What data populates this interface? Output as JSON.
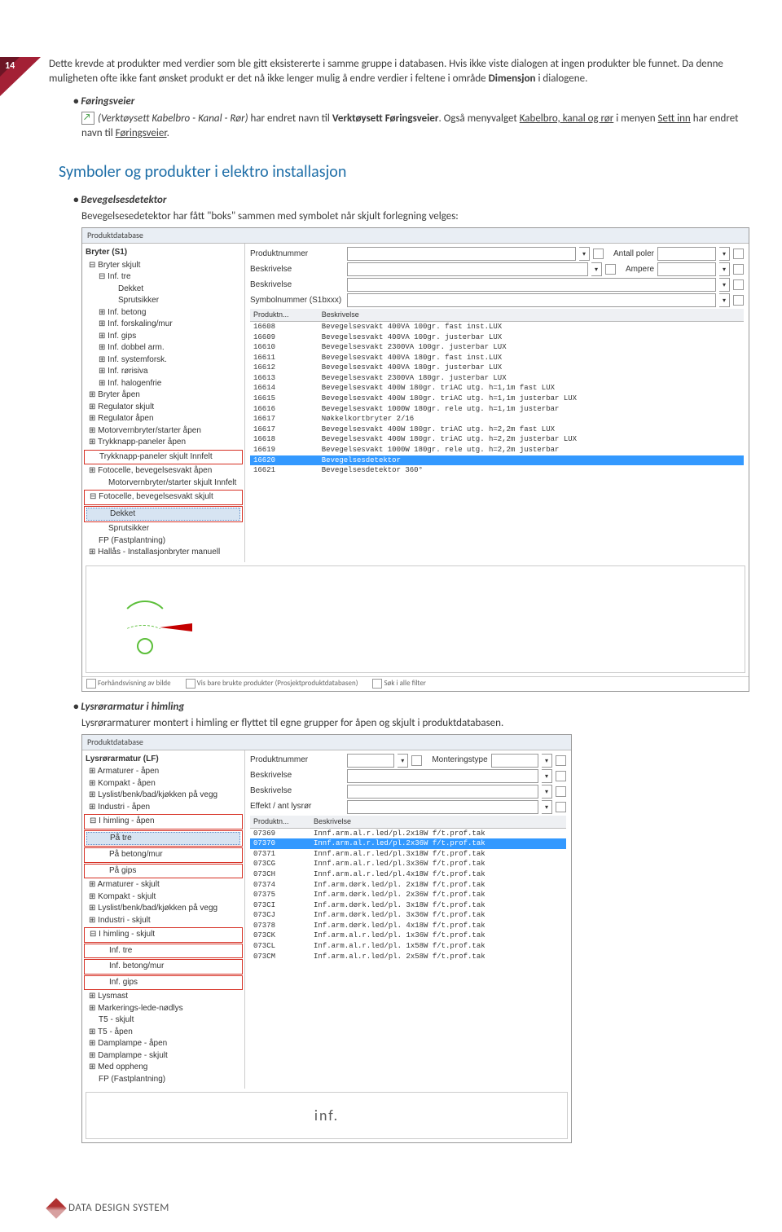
{
  "pagebadge": "14",
  "intro": {
    "para": "Dette krevde at produkter med verdier som ble gitt eksistererte i samme gruppe i databasen. Hvis ikke viste dialogen at ingen produkter ble funnet. Da denne muligheten ofte ikke fant ønsket produkt er det nå ikke lenger mulig å endre verdier i feltene i område ",
    "bold1": "Dimensjon",
    "para_end": " i dialogene."
  },
  "foringsveier": {
    "bullet": "Føringsveier",
    "text_a": "(Verktøysett Kabelbro - Kanal - Rør)",
    "text_b": " har endret navn til ",
    "bold": "Verktøysett Føringsveier",
    "text_c": ". Også menyvalget ",
    "link1": "Kabelbro, kanal og rør",
    "text_d": " i menyen ",
    "link2": "Sett inn",
    "text_e": " har endret navn til ",
    "link3": "Føringsveier",
    "text_f": "."
  },
  "h2": "Symboler og produkter i elektro  installasjon",
  "bevegelse": {
    "bullet": "Bevegelsesdetektor",
    "lead": "Bevegelsesedetektor har fått \"boks\" sammen med symbolet når skjult forlegning velges:",
    "title": "Produktdatabase",
    "tree_header": "Bryter (S1)",
    "tree": [
      {
        "ind": 0,
        "t": "Bryter skjult",
        "exp": "−"
      },
      {
        "ind": 1,
        "t": "Inf. tre",
        "exp": "−"
      },
      {
        "ind": 2,
        "t": "Dekket"
      },
      {
        "ind": 2,
        "t": "Sprutsikker"
      },
      {
        "ind": 1,
        "t": "Inf. betong",
        "exp": "+"
      },
      {
        "ind": 1,
        "t": "Inf. forskaling/mur",
        "exp": "+"
      },
      {
        "ind": 1,
        "t": "Inf. gips",
        "exp": "+"
      },
      {
        "ind": 1,
        "t": "Inf. dobbel arm.",
        "exp": "+"
      },
      {
        "ind": 1,
        "t": "Inf. systemforsk.",
        "exp": "+"
      },
      {
        "ind": 1,
        "t": "Inf. rørisiva",
        "exp": "+"
      },
      {
        "ind": 1,
        "t": "Inf. halogenfrie",
        "exp": "+"
      },
      {
        "ind": 0,
        "t": "Bryter åpen",
        "exp": "+"
      },
      {
        "ind": 0,
        "t": "Regulator skjult",
        "exp": "+"
      },
      {
        "ind": 0,
        "t": "Regulator åpen",
        "exp": "+"
      },
      {
        "ind": 0,
        "t": "Motorvernbryter/starter åpen",
        "exp": "+"
      },
      {
        "ind": 0,
        "t": "Trykknapp-paneler åpen",
        "exp": "+"
      },
      {
        "ind": 0,
        "t": "Trykknapp-paneler skjult Innfelt",
        "box": true
      },
      {
        "ind": 0,
        "t": "Fotocelle, bevegelsesvakt åpen",
        "exp": "+"
      },
      {
        "ind": 1,
        "t": "Motorvernbryter/starter skjult Innfelt"
      },
      {
        "ind": 0,
        "t": "Fotocelle, bevegelsesvakt skjult",
        "exp": "−",
        "box": true
      },
      {
        "ind": 1,
        "t": "Dekket",
        "sel": true,
        "box": true
      },
      {
        "ind": 1,
        "t": "Sprutsikker"
      },
      {
        "ind": 0,
        "t": "FP (Fastplantning)"
      },
      {
        "ind": 0,
        "t": "Hallås - Installasjonbryter manuell",
        "exp": "+"
      }
    ],
    "filters": [
      {
        "label": "Produktnummer",
        "right": "Antall poler"
      },
      {
        "label": "Beskrivelse",
        "right": "Ampere"
      },
      {
        "label": "Beskrivelse",
        "right": ""
      },
      {
        "label": "Symbolnummer (S1bxxx)",
        "right": ""
      }
    ],
    "cols": [
      "Produktn...",
      "Beskrivelse"
    ],
    "rows": [
      {
        "id": "16608",
        "d": "Bevegelsesvakt 400VA 100gr. fast inst.LUX"
      },
      {
        "id": "16609",
        "d": "Bevegelsesvakt 400VA 100gr. justerbar LUX"
      },
      {
        "id": "16610",
        "d": "Bevegelsesvakt 2300VA 100gr. justerbar LUX"
      },
      {
        "id": "16611",
        "d": "Bevegelsesvakt 400VA 180gr. fast inst.LUX"
      },
      {
        "id": "16612",
        "d": "Bevegelsesvakt 400VA 180gr. justerbar LUX"
      },
      {
        "id": "16613",
        "d": "Bevegelsesvakt 2300VA 180gr. justerbar LUX"
      },
      {
        "id": "16614",
        "d": "Bevegelsesvakt 400W 180gr. triAC utg. h=1,1m fast LUX"
      },
      {
        "id": "16615",
        "d": "Bevegelsesvakt 400W 180gr. triAC utg. h=1,1m justerbar LUX"
      },
      {
        "id": "16616",
        "d": "Bevegelsesvakt 1000W 180gr. rele utg. h=1,1m justerbar"
      },
      {
        "id": "16617",
        "d": "Nøkkelkortbryter 2/16"
      },
      {
        "id": "16617",
        "d": "Bevegelsesvakt 400W 180gr. triAC utg. h=2,2m fast LUX"
      },
      {
        "id": "16618",
        "d": "Bevegelsesvakt 400W 180gr. triAC utg. h=2,2m justerbar LUX"
      },
      {
        "id": "16619",
        "d": "Bevegelsesvakt 1000W 180gr. rele utg. h=2,2m justerbar"
      },
      {
        "id": "16620",
        "d": "Bevegelsesdetektor",
        "hl": true
      },
      {
        "id": "16621",
        "d": "Bevegelsesdetektor 360°"
      }
    ],
    "status": {
      "a": "Forhåndsvisning av bilde",
      "b": "Vis bare brukte produkter (Prosjektproduktdatabasen)",
      "c": "Søk i alle filter"
    }
  },
  "lysror": {
    "bullet": "Lysrørarmatur i himling",
    "lead": "Lysrørarmaturer montert i himling er flyttet til egne grupper for åpen og skjult i produktdatabasen.",
    "title": "Produktdatabase",
    "tree_header": "Lysrørarmatur (LF)",
    "tree": [
      {
        "ind": 0,
        "t": "Armaturer - åpen",
        "exp": "+"
      },
      {
        "ind": 0,
        "t": "Kompakt - åpen",
        "exp": "+"
      },
      {
        "ind": 0,
        "t": "Lyslist/benk/bad/kjøkken på vegg",
        "exp": "+"
      },
      {
        "ind": 0,
        "t": "Industri - åpen",
        "exp": "+"
      },
      {
        "ind": 0,
        "t": "I himling - åpen",
        "exp": "−",
        "box": true
      },
      {
        "ind": 1,
        "t": "På tre",
        "sel": true,
        "box": true
      },
      {
        "ind": 1,
        "t": "På betong/mur",
        "box": true
      },
      {
        "ind": 1,
        "t": "På gips",
        "box": true
      },
      {
        "ind": 0,
        "t": "Armaturer - skjult",
        "exp": "+"
      },
      {
        "ind": 0,
        "t": "Kompakt - skjult",
        "exp": "+"
      },
      {
        "ind": 0,
        "t": "Lyslist/benk/bad/kjøkken på vegg",
        "exp": "+"
      },
      {
        "ind": 0,
        "t": "Industri - skjult",
        "exp": "+"
      },
      {
        "ind": 0,
        "t": "I himling - skjult",
        "exp": "−",
        "box": true
      },
      {
        "ind": 1,
        "t": "Inf. tre",
        "box": true
      },
      {
        "ind": 1,
        "t": "Inf. betong/mur",
        "box": true
      },
      {
        "ind": 1,
        "t": "Inf. gips",
        "box": true
      },
      {
        "ind": 0,
        "t": "Lysmast",
        "exp": "+"
      },
      {
        "ind": 0,
        "t": "Markerings-lede-nødlys",
        "exp": "+"
      },
      {
        "ind": 0,
        "t": "T5 - skjult"
      },
      {
        "ind": 0,
        "t": "T5 - åpen",
        "exp": "+"
      },
      {
        "ind": 0,
        "t": "Damplampe - åpen",
        "exp": "+"
      },
      {
        "ind": 0,
        "t": "Damplampe - skjult",
        "exp": "+"
      },
      {
        "ind": 0,
        "t": "Med oppheng",
        "exp": "+"
      },
      {
        "ind": 0,
        "t": "FP (Fastplantning)"
      }
    ],
    "filters": [
      {
        "label": "Produktnummer",
        "right": "Monteringstype"
      },
      {
        "label": "Beskrivelse",
        "right": ""
      },
      {
        "label": "Beskrivelse",
        "right": ""
      },
      {
        "label": "Effekt / ant lysrør",
        "right": ""
      }
    ],
    "cols": [
      "Produktn...",
      "Beskrivelse"
    ],
    "rows": [
      {
        "id": "07369",
        "d": "Innf.arm.al.r.led/pl.2x18W f/t.prof.tak"
      },
      {
        "id": "07370",
        "d": "Innf.arm.al.r.led/pl.2x36W f/t.prof.tak",
        "hl": true
      },
      {
        "id": "07371",
        "d": "Innf.arm.al.r.led/pl.3x18W f/t.prof.tak"
      },
      {
        "id": "073CG",
        "d": "Innf.arm.al.r.led/pl.3x36W f/t.prof.tak"
      },
      {
        "id": "073CH",
        "d": "Innf.arm.al.r.led/pl.4x18W f/t.prof.tak"
      },
      {
        "id": "07374",
        "d": "Inf.arm.dørk.led/pl. 2x18W f/t.prof.tak"
      },
      {
        "id": "07375",
        "d": "Inf.arm.dørk.led/pl. 2x36W f/t.prof.tak"
      },
      {
        "id": "073CI",
        "d": "Inf.arm.dørk.led/pl. 3x18W f/t.prof.tak"
      },
      {
        "id": "073CJ",
        "d": "Inf.arm.dørk.led/pl. 3x36W f/t.prof.tak"
      },
      {
        "id": "07378",
        "d": "Inf.arm.dørk.led/pl. 4x18W f/t.prof.tak"
      },
      {
        "id": "073CK",
        "d": "Inf.arm.al.r.led/pl. 1x36W f/t.prof.tak"
      },
      {
        "id": "073CL",
        "d": "Inf.arm.al.r.led/pl. 1x58W f/t.prof.tak"
      },
      {
        "id": "073CM",
        "d": "Inf.arm.al.r.led/pl. 2x58W f/t.prof.tak"
      }
    ],
    "preview": "inf."
  },
  "footer": "DATA DESIGN SYSTEM"
}
